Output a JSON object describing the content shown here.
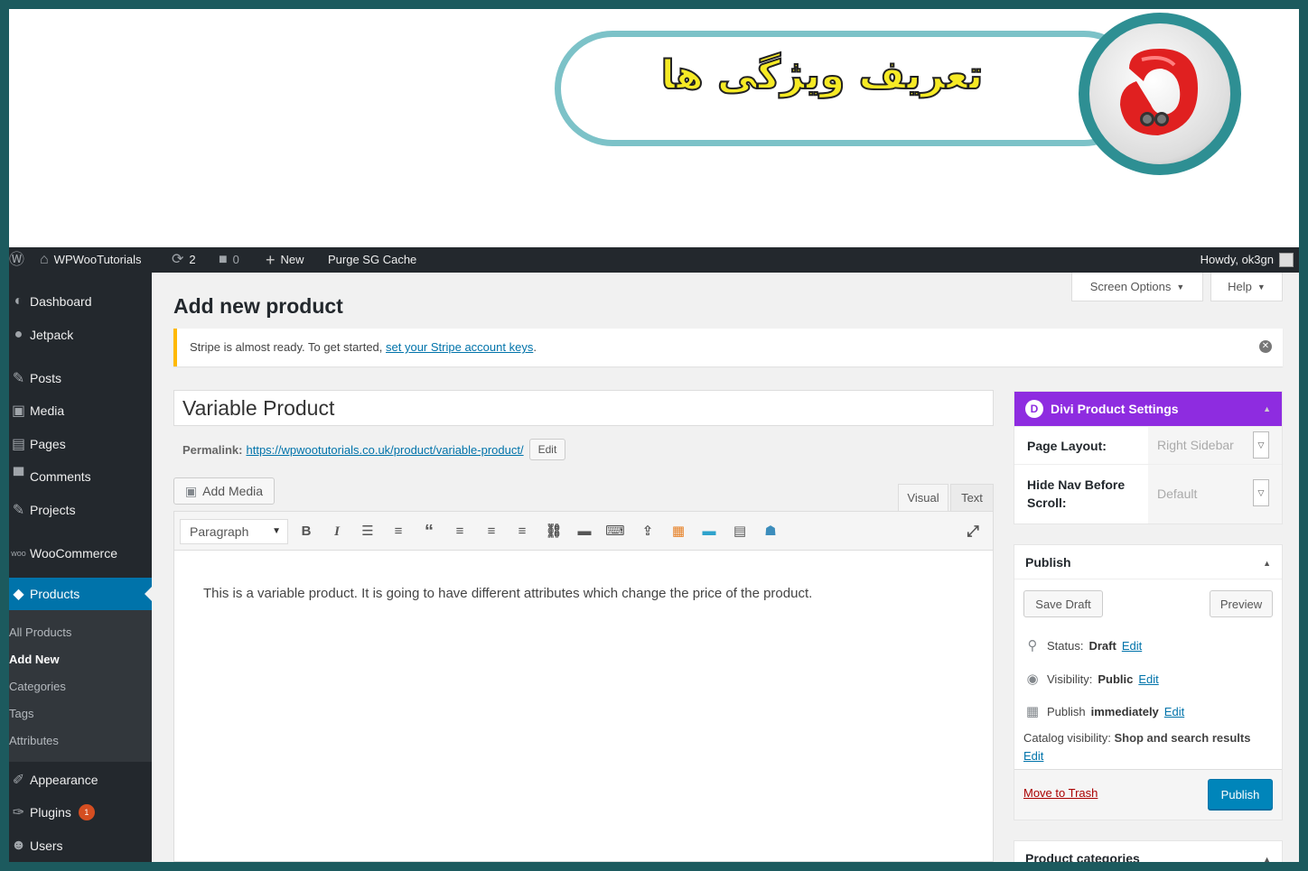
{
  "banner": {
    "title": "تعریف ویژگی ها",
    "logo_icon": "brand-logo-icon"
  },
  "adminbar": {
    "site_name": "WPWooTutorials",
    "updates_count": "2",
    "comments_count": "0",
    "new_label": "New",
    "purge_label": "Purge SG Cache",
    "howdy": "Howdy, ok3gn"
  },
  "sidebar": {
    "items": [
      {
        "label": "Dashboard",
        "icon": "dashboard-icon"
      },
      {
        "label": "Jetpack",
        "icon": "jetpack-icon"
      },
      {
        "label": "Posts",
        "icon": "pin-icon"
      },
      {
        "label": "Media",
        "icon": "media-icon"
      },
      {
        "label": "Pages",
        "icon": "pages-icon"
      },
      {
        "label": "Comments",
        "icon": "comments-icon"
      },
      {
        "label": "Projects",
        "icon": "pin-icon"
      },
      {
        "label": "WooCommerce",
        "icon": "woo-icon"
      },
      {
        "label": "Products",
        "icon": "products-icon"
      },
      {
        "label": "Appearance",
        "icon": "brush-icon"
      },
      {
        "label": "Plugins",
        "icon": "plugin-icon",
        "badge": "1"
      },
      {
        "label": "Users",
        "icon": "users-icon"
      }
    ],
    "submenu": [
      "All Products",
      "Add New",
      "Categories",
      "Tags",
      "Attributes"
    ]
  },
  "header": {
    "screen_options": "Screen Options",
    "help": "Help",
    "page_title": "Add new product"
  },
  "notice": {
    "text": "Stripe is almost ready. To get started, ",
    "link": "set your Stripe account keys",
    "tail": "."
  },
  "editor": {
    "title_value": "Variable Product",
    "permalink_label": "Permalink:",
    "permalink_url": "https://wpwootutorials.co.uk/product/variable-product/",
    "permalink_edit": "Edit",
    "add_media": "Add Media",
    "tab_visual": "Visual",
    "tab_text": "Text",
    "format_value": "Paragraph",
    "content": "This is a variable product. It is going to have different attributes which change the price of the product."
  },
  "divi": {
    "title": "Divi Product Settings",
    "page_layout_label": "Page Layout:",
    "page_layout_value": "Right Sidebar",
    "hide_nav_label_1": "Hide Nav Before",
    "hide_nav_label_2": "Scroll:",
    "hide_nav_value": "Default"
  },
  "publish": {
    "title": "Publish",
    "save_draft": "Save Draft",
    "preview": "Preview",
    "status_label": "Status:",
    "status_value": "Draft",
    "visibility_label": "Visibility:",
    "visibility_value": "Public",
    "publish_label": "Publish",
    "publish_value": "immediately",
    "edit": "Edit",
    "catalog_label": "Catalog visibility:",
    "catalog_value": "Shop and search results",
    "move_to_trash": "Move to Trash",
    "publish_button": "Publish"
  },
  "product_categories": {
    "title": "Product categories"
  },
  "colors": {
    "admin_bar": "#23282d",
    "accent": "#0073aa",
    "divi_purple": "#8e2ce0",
    "notice_border": "#ffb900",
    "publish_button": "#0085ba"
  }
}
